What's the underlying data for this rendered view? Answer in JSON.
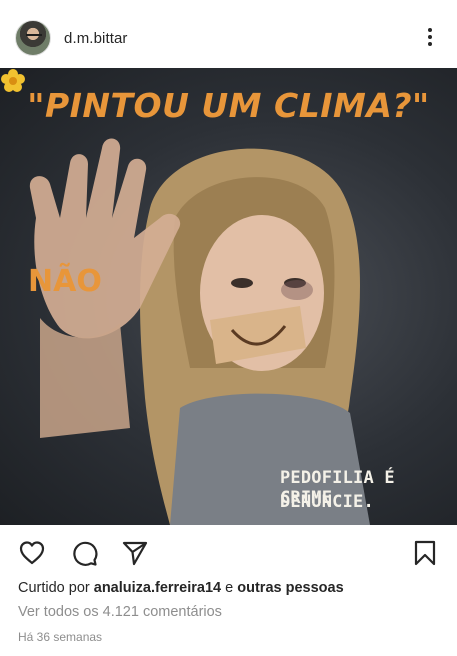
{
  "header": {
    "username": "d.m.bittar",
    "avatar_icon": "profile-avatar",
    "more_icon": "vertical-ellipsis-icon"
  },
  "image": {
    "title": "\"PINTOU UM CLIMA?\"",
    "hand_text": "NÃO",
    "bottom_line1": "PEDOFILIA É CRIME",
    "bottom_line2": "DENUNCIE.",
    "accent_color": "#e8963a",
    "flower_icon": "yellow-flower-icon"
  },
  "actions": {
    "like_icon": "heart-icon",
    "comment_icon": "comment-bubble-icon",
    "share_icon": "paper-plane-icon",
    "save_icon": "bookmark-icon"
  },
  "likes": {
    "prefix": "Curtido por",
    "user": "analuiza.ferreira14",
    "connector": "e",
    "others": "outras pessoas"
  },
  "comments_link": "Ver todos os 4.121 comentários",
  "timestamp": "Há 36 semanas"
}
